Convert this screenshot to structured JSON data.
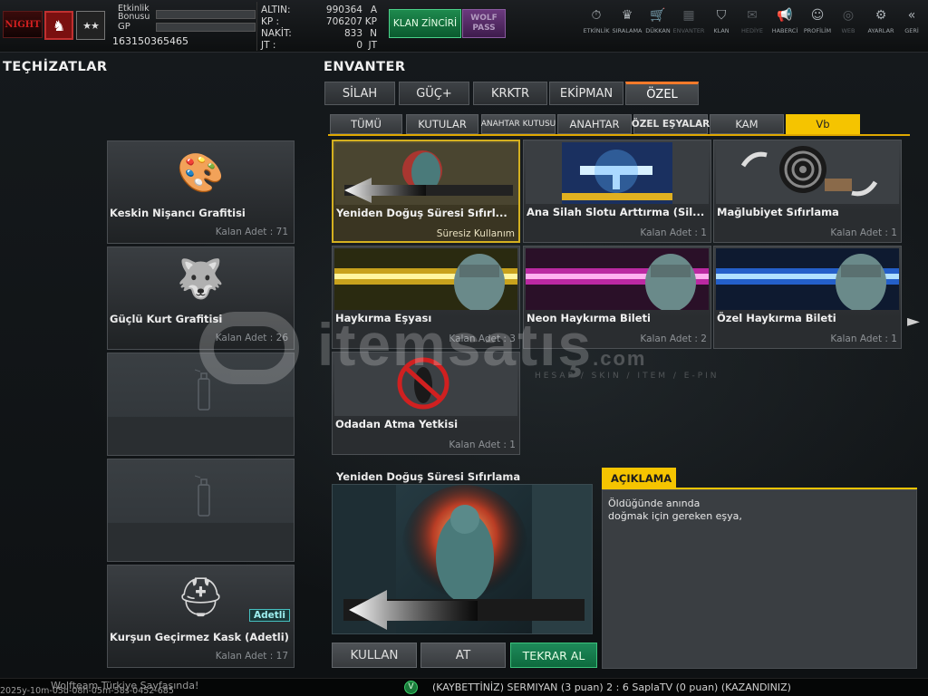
{
  "header": {
    "logo_text": "NIGHT",
    "rank_symbol": "♞",
    "stars": "★★",
    "event_bonus_label": "Etkinlik Bonusu",
    "gp_label": "GP",
    "user_id": "163150365465",
    "stats": [
      {
        "name": "ALTIN:",
        "value": "990364",
        "unit": "A"
      },
      {
        "name": "KP :",
        "value": "706207",
        "unit": "KP"
      },
      {
        "name": "NAKİT:",
        "value": "833",
        "unit": "N"
      },
      {
        "name": "JT :",
        "value": "0",
        "unit": "JT"
      }
    ],
    "clan_chain_label": "KLAN ZİNCİRİ",
    "wolf_pass_label": "WOLF PASS",
    "nav": [
      {
        "label": "ETKİNLİK",
        "icon": "⏱"
      },
      {
        "label": "SIRALAMA",
        "icon": "♛"
      },
      {
        "label": "DÜKKAN",
        "icon": "🛒"
      },
      {
        "label": "ENVANTER",
        "icon": "▦"
      },
      {
        "label": "KLAN",
        "icon": "⛉"
      },
      {
        "label": "HEDİYE",
        "icon": "✉"
      },
      {
        "label": "HABERCİ",
        "icon": "📢"
      },
      {
        "label": "PROFİLİM",
        "icon": "☺"
      },
      {
        "label": "WEB",
        "icon": "◎"
      },
      {
        "label": "AYARLAR",
        "icon": "⚙"
      },
      {
        "label": "GERİ",
        "icon": "«"
      }
    ]
  },
  "equipment": {
    "title": "TEÇHİZATLAR",
    "items": [
      {
        "name": "Keskin Nişancı Grafitisi",
        "count": "Kalan Adet : 71",
        "icon": "🎨"
      },
      {
        "name": "Güçlü Kurt Grafitisi",
        "count": "Kalan Adet : 26",
        "icon": "🐺"
      },
      {
        "name": "",
        "count": "",
        "icon": ""
      },
      {
        "name": "",
        "count": "",
        "icon": ""
      },
      {
        "name": "Kurşun Geçirmez Kask (Adetli)",
        "count": "Kalan Adet : 17",
        "icon": "⛑",
        "badge": "Adetli"
      }
    ]
  },
  "inventory": {
    "title": "ENVANTER",
    "tabs": [
      "SİLAH",
      "GÜÇ+",
      "KRKTR",
      "EKİPMAN",
      "ÖZEL"
    ],
    "subtabs": [
      "TÜMÜ",
      "KUTULAR",
      "ANAHTAR KUTUSU",
      "ANAHTAR",
      "ÖZEL EŞYALAR",
      "KAM",
      "Vb"
    ],
    "items": [
      {
        "name": "Yeniden Doğuş Süresi Sıfırl...",
        "count": "Süresiz Kullanım"
      },
      {
        "name": "Ana Silah Slotu Arttırma (Sil...",
        "count": "Kalan Adet : 1"
      },
      {
        "name": "Mağlubiyet Sıfırlama",
        "count": "Kalan Adet : 1"
      },
      {
        "name": "Haykırma Eşyası",
        "count": "Kalan Adet : 3"
      },
      {
        "name": "Neon Haykırma Bileti",
        "count": "Kalan Adet : 2"
      },
      {
        "name": "Özel Haykırma Bileti",
        "count": "Kalan Adet : 1"
      },
      {
        "name": "Odadan Atma Yetkisi",
        "count": "Kalan Adet : 1"
      }
    ]
  },
  "preview": {
    "title": "Yeniden Doğuş Süresi Sıfırlama",
    "desc_tab": "AÇIKLAMA",
    "desc_line1": "Öldüğünde anında",
    "desc_line2": "doğmak için gereken eşya,"
  },
  "actions": {
    "use": "KULLAN",
    "drop": "AT",
    "rebuy": "TEKRAR AL"
  },
  "watermark": {
    "text": "itemsatış",
    "sub": "HESAP / SKIN / ITEM / E-PIN",
    "suffix": ".com"
  },
  "bottom": {
    "ticker_left": "Wolfteam Türkiye Sayfasında!",
    "timestamp": "2025y-10m-05d-08h-05m-58s-0452-685",
    "ticker_right": "(KAYBETTİNİZ) SERMIYAN (3 puan) 2 : 6 SaplaTV (0 puan) (KAZANDINIZ)"
  },
  "colors": {
    "accent_yellow": "#f5c400",
    "accent_orange": "#ff7a2a",
    "green_button": "#1e8a5a"
  }
}
